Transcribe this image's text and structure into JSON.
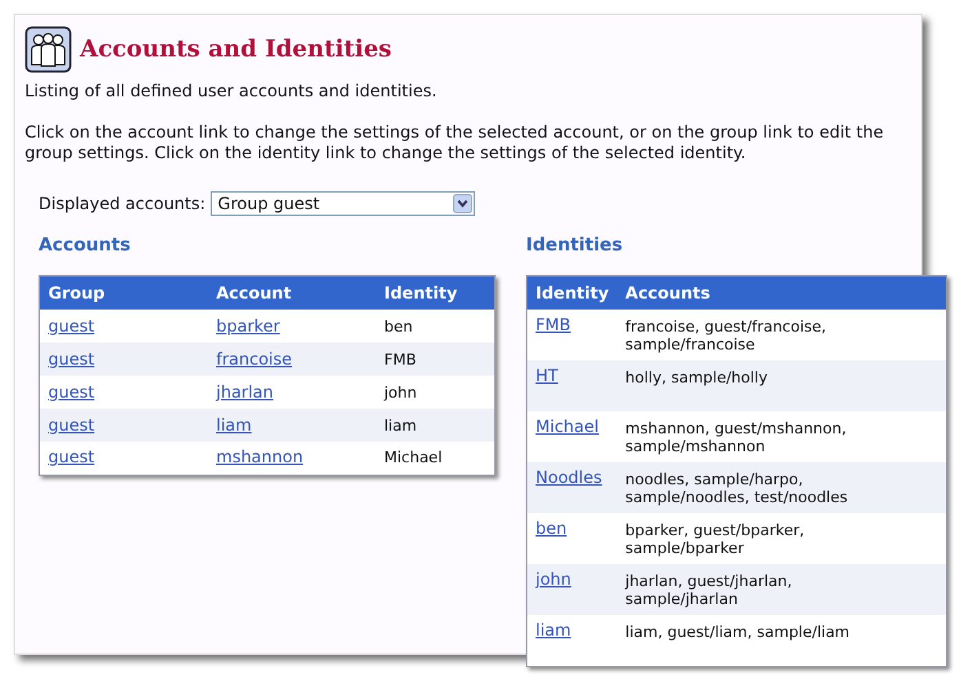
{
  "header": {
    "title": "Accounts and Identities"
  },
  "intro": "Listing of all defined user accounts and identities.",
  "instructions": "Click on the account link to change the settings of the selected account, or on the group link to edit the group settings. Click on the identity link to change the settings of the selected identity.",
  "filter": {
    "label": "Displayed accounts:",
    "value": "Group guest"
  },
  "accounts": {
    "heading": "Accounts",
    "columns": [
      "Group",
      "Account",
      "Identity"
    ],
    "rows": [
      {
        "group": "guest",
        "account": "bparker",
        "identity": "ben"
      },
      {
        "group": "guest",
        "account": "francoise",
        "identity": "FMB"
      },
      {
        "group": "guest",
        "account": "jharlan",
        "identity": "john"
      },
      {
        "group": "guest",
        "account": "liam",
        "identity": "liam"
      },
      {
        "group": "guest",
        "account": "mshannon",
        "identity": "Michael"
      }
    ]
  },
  "identities": {
    "heading": "Identities",
    "columns": [
      "Identity",
      "Accounts"
    ],
    "rows": [
      {
        "identity": "FMB",
        "accounts": "francoise, guest/francoise, sample/francoise"
      },
      {
        "identity": "HT",
        "accounts": "holly, sample/holly"
      },
      {
        "identity": "Michael",
        "accounts": "mshannon, guest/mshannon, sample/mshannon"
      },
      {
        "identity": "Noodles",
        "accounts": "noodles, sample/harpo, sample/noodles, test/noodles"
      },
      {
        "identity": "ben",
        "accounts": "bparker, guest/bparker, sample/bparker"
      },
      {
        "identity": "john",
        "accounts": "jharlan, guest/jharlan, sample/jharlan"
      },
      {
        "identity": "liam",
        "accounts": "liam, guest/liam, sample/liam"
      }
    ]
  }
}
